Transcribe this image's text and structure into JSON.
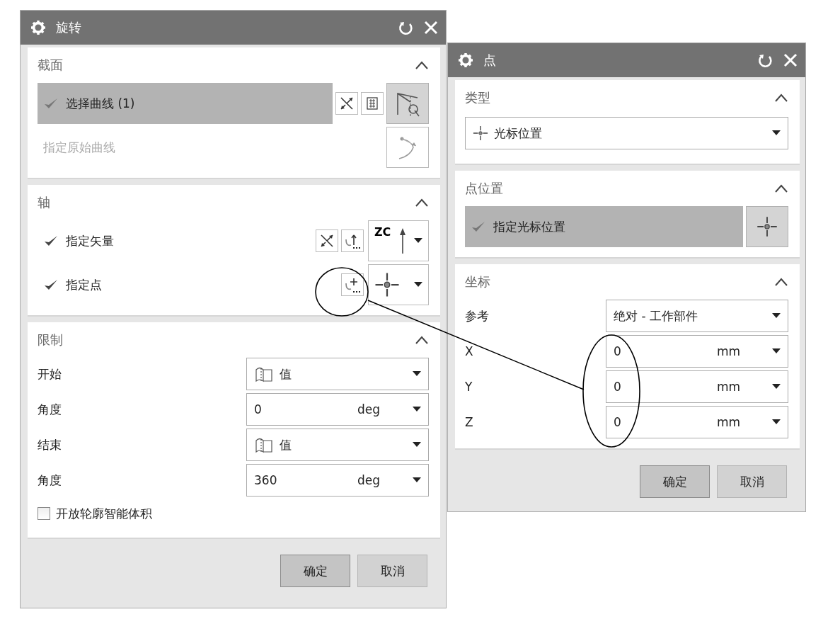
{
  "dialogs": [
    {
      "title": "旋转",
      "sections": [
        {
          "title": "截面",
          "expanded": true,
          "rows": [
            {
              "kind": "selection",
              "label": "选择曲线 (1)",
              "checked": true,
              "active": true,
              "disabled": false,
              "tools": [
                {
                  "kind": "reverse",
                  "pressed": false
                },
                {
                  "kind": "sketch",
                  "pressed": false
                },
                {
                  "kind": "curve-rule",
                  "pressed": true
                }
              ]
            },
            {
              "kind": "selection",
              "label": "指定原始曲线",
              "checked": false,
              "active": false,
              "disabled": true,
              "tools": [
                {
                  "kind": "origin-curve",
                  "pressed": false
                }
              ]
            }
          ]
        },
        {
          "title": "轴",
          "expanded": true,
          "rows": [
            {
              "kind": "selection",
              "label": "指定矢量",
              "checked": true,
              "active": false,
              "disabled": false,
              "tools": [
                {
                  "kind": "reverse",
                  "pressed": false
                },
                {
                  "kind": "vector-dialog",
                  "pressed": false
                }
              ],
              "picker": {
                "kind": "vector",
                "text": "ZC"
              }
            },
            {
              "kind": "selection",
              "label": "指定点",
              "checked": true,
              "active": false,
              "disabled": false,
              "tools": [
                {
                  "kind": "point-dialog",
                  "pressed": false
                }
              ],
              "picker": {
                "kind": "point"
              }
            }
          ]
        },
        {
          "title": "限制",
          "expanded": true,
          "rows": [
            {
              "kind": "select",
              "label": "开始",
              "value": "值"
            },
            {
              "kind": "number",
              "label": "角度",
              "value": "0",
              "unit": "deg"
            },
            {
              "kind": "select",
              "label": "结束",
              "value": "值"
            },
            {
              "kind": "number",
              "label": "角度",
              "value": "360",
              "unit": "deg"
            },
            {
              "kind": "checkbox",
              "label": "开放轮廓智能体积",
              "checked": false
            }
          ]
        }
      ],
      "buttons": [
        {
          "label": "确定",
          "default": true
        },
        {
          "label": "取消",
          "default": false
        }
      ]
    },
    {
      "title": "点",
      "sections": [
        {
          "title": "类型",
          "expanded": true,
          "rows": [
            {
              "kind": "select",
              "value": "光标位置"
            }
          ]
        },
        {
          "title": "点位置",
          "expanded": true,
          "rows": [
            {
              "kind": "selection",
              "label": "指定光标位置",
              "checked": true,
              "active": true,
              "disabled": false,
              "tools": [
                {
                  "kind": "point",
                  "pressed": true
                }
              ]
            }
          ]
        },
        {
          "title": "坐标",
          "expanded": true,
          "rows": [
            {
              "kind": "select",
              "label": "参考",
              "value": "绝对 - 工作部件"
            },
            {
              "kind": "number",
              "label": "X",
              "value": "0",
              "unit": "mm"
            },
            {
              "kind": "number",
              "label": "Y",
              "value": "0",
              "unit": "mm"
            },
            {
              "kind": "number",
              "label": "Z",
              "value": "0",
              "unit": "mm"
            }
          ]
        }
      ],
      "buttons": [
        {
          "label": "确定",
          "default": true
        },
        {
          "label": "取消",
          "default": false
        }
      ]
    }
  ]
}
